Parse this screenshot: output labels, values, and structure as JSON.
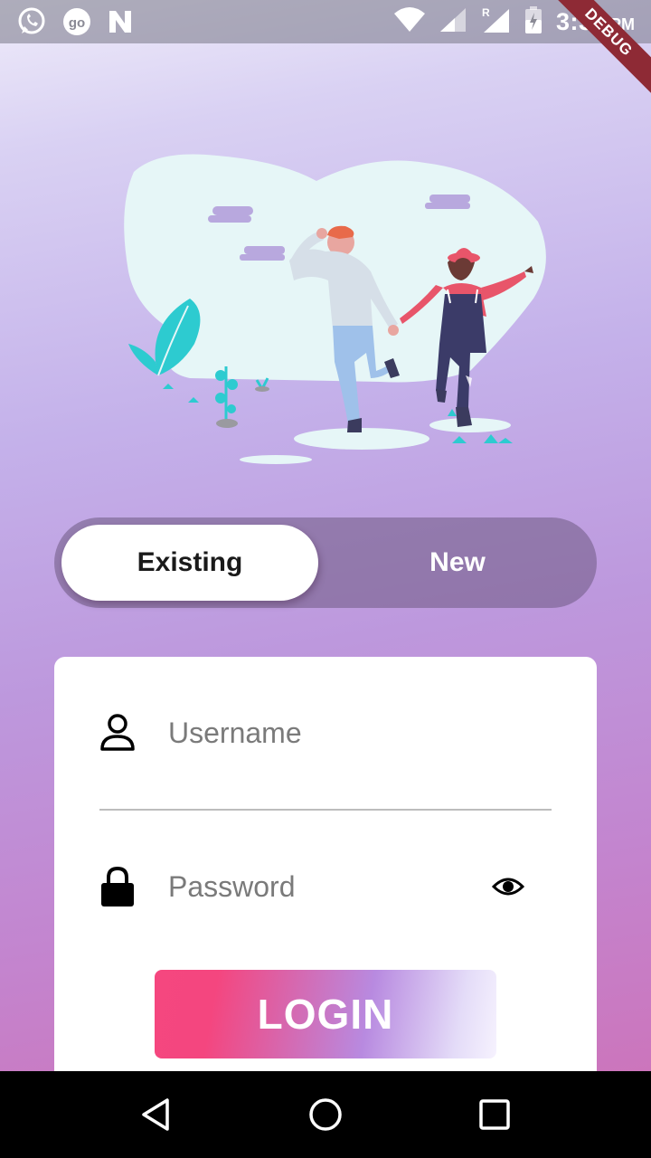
{
  "status_bar": {
    "time": "3:34",
    "ampm": "PM",
    "left_icons": [
      "whatsapp-icon",
      "go-icon",
      "n-icon"
    ],
    "right_icons": [
      "wifi-icon",
      "signal-icon",
      "signal-roaming-icon",
      "battery-icon"
    ]
  },
  "debug_banner": "DEBUG",
  "toggle": {
    "existing_label": "Existing",
    "new_label": "New",
    "selected": "Existing"
  },
  "form": {
    "username_placeholder": "Username",
    "username_value": "",
    "password_placeholder": "Password",
    "password_value": "",
    "login_label": "LOGIN"
  },
  "nav_bar": {
    "buttons": [
      "back-icon",
      "home-icon",
      "recents-icon"
    ]
  },
  "colors": {
    "accent_pink": "#f5477f",
    "accent_purple": "#b88ae0"
  }
}
